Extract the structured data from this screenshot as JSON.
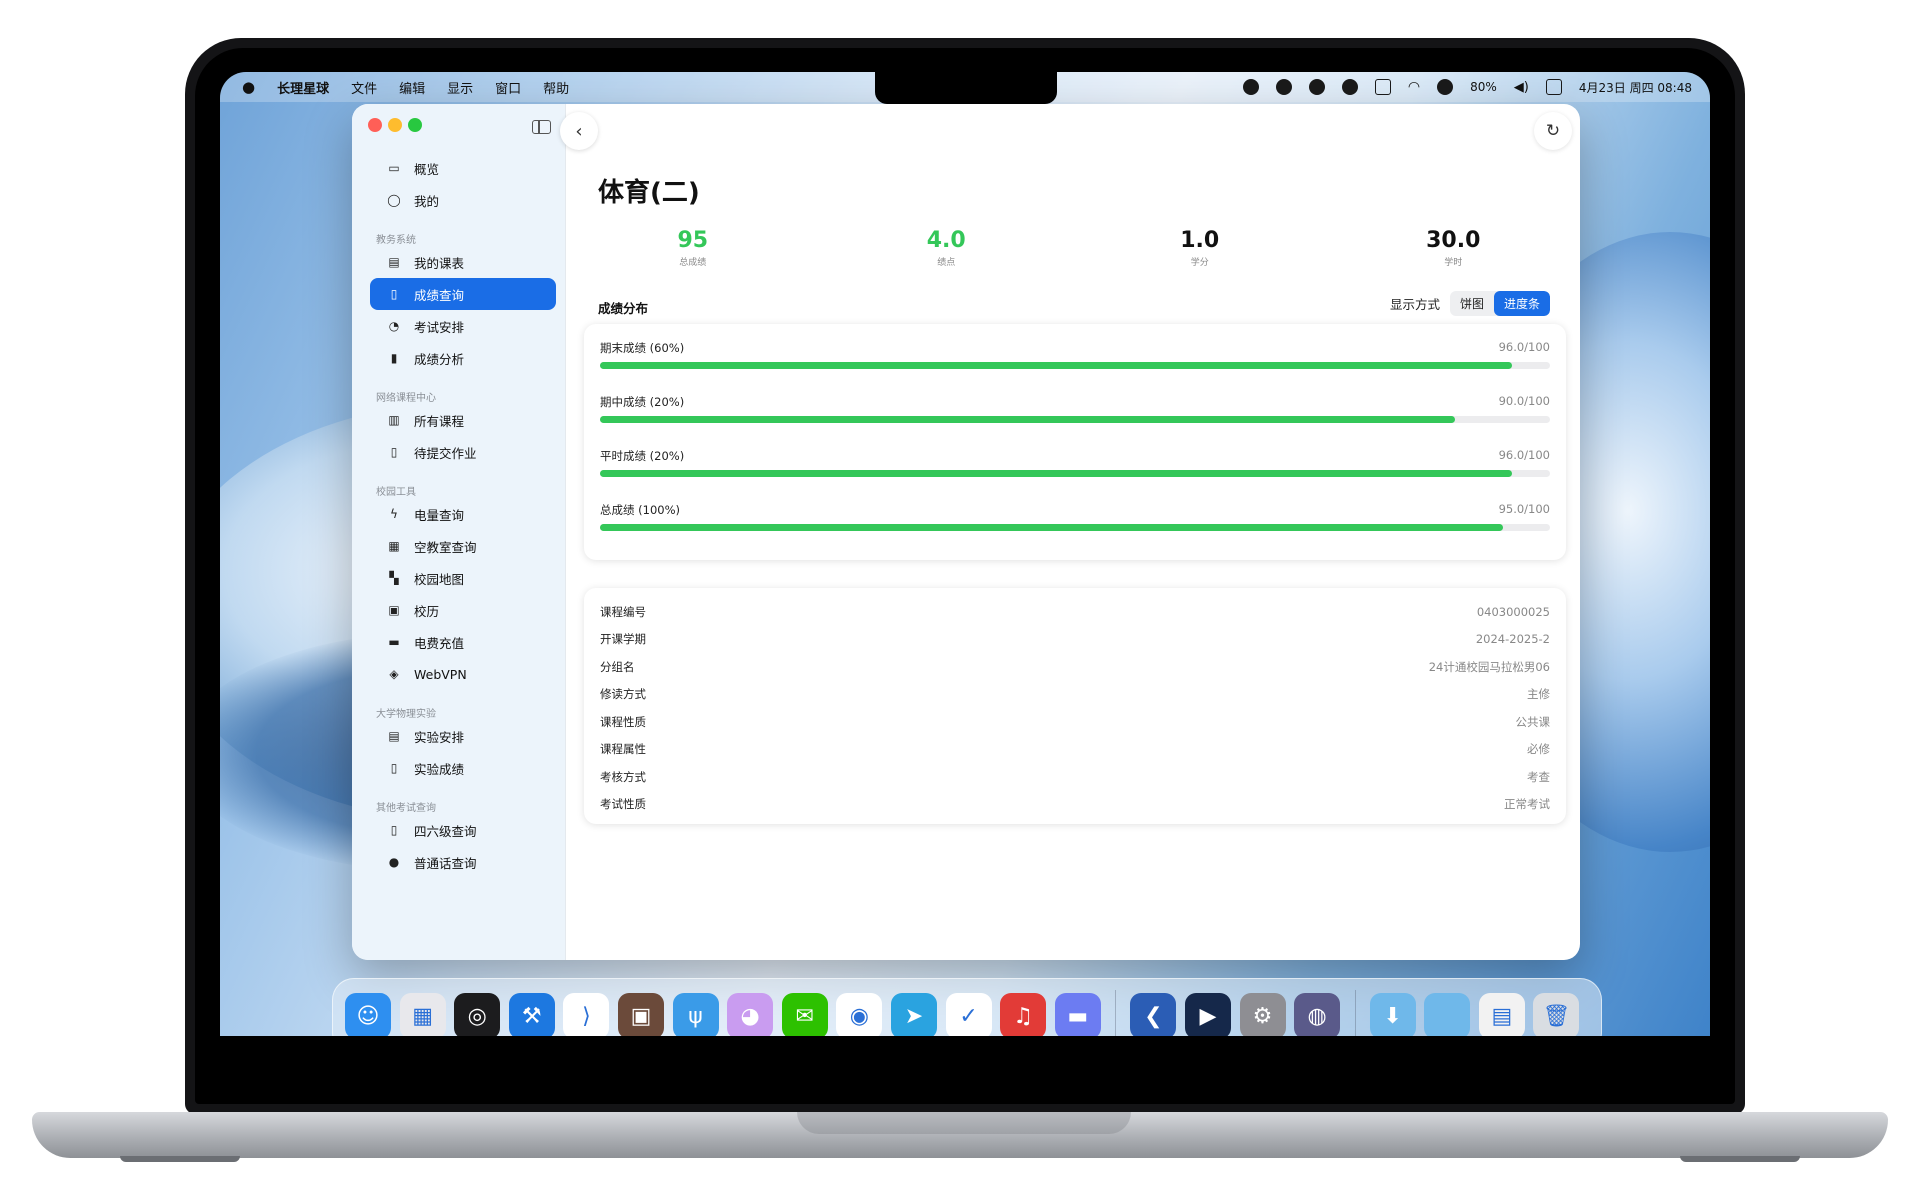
{
  "menubar": {
    "apple_icon": "apple-logo",
    "app_name": "长理星球",
    "menus": [
      "文件",
      "编辑",
      "显示",
      "窗口",
      "帮助"
    ],
    "battery": "80%",
    "datetime": "4月23日 周四 08:48"
  },
  "sidebar": {
    "top_items": [
      {
        "icon": "overview-icon",
        "label": "概览"
      },
      {
        "icon": "person-icon",
        "label": "我的"
      }
    ],
    "sections": [
      {
        "title": "教务系统",
        "items": [
          {
            "icon": "calendar-icon",
            "label": "我的课表"
          },
          {
            "icon": "document-search-icon",
            "label": "成绩查询",
            "active": true
          },
          {
            "icon": "exam-icon",
            "label": "考试安排"
          },
          {
            "icon": "chart-icon",
            "label": "成绩分析"
          }
        ]
      },
      {
        "title": "网络课程中心",
        "items": [
          {
            "icon": "books-icon",
            "label": "所有课程"
          },
          {
            "icon": "clipboard-icon",
            "label": "待提交作业"
          }
        ]
      },
      {
        "title": "校园工具",
        "items": [
          {
            "icon": "bolt-icon",
            "label": "电量查询"
          },
          {
            "icon": "building-icon",
            "label": "空教室查询"
          },
          {
            "icon": "map-icon",
            "label": "校园地图"
          },
          {
            "icon": "calendar-badge-icon",
            "label": "校历"
          },
          {
            "icon": "card-icon",
            "label": "电费充值"
          },
          {
            "icon": "shield-icon",
            "label": "WebVPN"
          }
        ]
      },
      {
        "title": "大学物理实验",
        "items": [
          {
            "icon": "calendar-icon",
            "label": "实验安排"
          },
          {
            "icon": "document-icon",
            "label": "实验成绩"
          }
        ]
      },
      {
        "title": "其他考试查询",
        "items": [
          {
            "icon": "document-icon",
            "label": "四六级查询"
          },
          {
            "icon": "exclamation-icon",
            "label": "普通话查询"
          }
        ]
      }
    ]
  },
  "course": {
    "title": "体育(二)",
    "stats": [
      {
        "value": "95",
        "label": "总成绩",
        "color": "#34c759"
      },
      {
        "value": "4.0",
        "label": "绩点",
        "color": "#34c759"
      },
      {
        "value": "1.0",
        "label": "学分",
        "color": "#111111"
      },
      {
        "value": "30.0",
        "label": "学时",
        "color": "#111111"
      }
    ]
  },
  "distribution": {
    "heading": "成绩分布",
    "mode_label": "显示方式",
    "mode_options": [
      "饼图",
      "进度条"
    ],
    "selected_mode": "进度条",
    "bars": [
      {
        "label": "期末成绩 (60%)",
        "value_text": "96.0/100",
        "fraction": 0.96
      },
      {
        "label": "期中成绩 (20%)",
        "value_text": "90.0/100",
        "fraction": 0.9
      },
      {
        "label": "平时成绩 (20%)",
        "value_text": "96.0/100",
        "fraction": 0.96
      },
      {
        "label": "总成绩 (100%)",
        "value_text": "95.0/100",
        "fraction": 0.95
      }
    ],
    "bar_color": "#34c759"
  },
  "info": [
    {
      "key": "课程编号",
      "value": "0403000025"
    },
    {
      "key": "开课学期",
      "value": "2024-2025-2"
    },
    {
      "key": "分组名",
      "value": "24计通校园马拉松男06"
    },
    {
      "key": "修读方式",
      "value": "主修"
    },
    {
      "key": "课程性质",
      "value": "公共课"
    },
    {
      "key": "课程属性",
      "value": "必修"
    },
    {
      "key": "考核方式",
      "value": "考查"
    },
    {
      "key": "考试性质",
      "value": "正常考试"
    }
  ],
  "dock": {
    "apps": [
      {
        "name": "finder-icon",
        "color": "#2e8ff0",
        "glyph": "☺",
        "running": true
      },
      {
        "name": "launchpad-icon",
        "color": "#e8e8ec",
        "glyph": "▦",
        "running": false
      },
      {
        "name": "siri-icon",
        "color": "#1c1c1e",
        "glyph": "◎",
        "running": true
      },
      {
        "name": "xcode-icon",
        "color": "#1d78e0",
        "glyph": "⚒",
        "running": true
      },
      {
        "name": "vscode-icon",
        "color": "#ffffff",
        "glyph": "⟩",
        "running": false
      },
      {
        "name": "terminal-cat-icon",
        "color": "#6b4a3a",
        "glyph": "▣",
        "running": true
      },
      {
        "name": "fork-icon",
        "color": "#3a9be8",
        "glyph": "ψ",
        "running": false
      },
      {
        "name": "cat-app-icon",
        "color": "#c99cf0",
        "glyph": "◕",
        "running": true
      },
      {
        "name": "wechat-icon",
        "color": "#2dc100",
        "glyph": "✉",
        "running": false
      },
      {
        "name": "qq-icon",
        "color": "#ffffff",
        "glyph": "◉",
        "running": true
      },
      {
        "name": "telegram-icon",
        "color": "#2aa3e0",
        "glyph": "➤",
        "running": true
      },
      {
        "name": "mail-app-icon",
        "color": "#ffffff",
        "glyph": "✓",
        "running": false
      },
      {
        "name": "netease-music-icon",
        "color": "#e23b37",
        "glyph": "♫",
        "running": true
      },
      {
        "name": "messages-icon",
        "color": "#6c7cf2",
        "glyph": "▬",
        "running": true
      }
    ],
    "apps2": [
      {
        "name": "kodi-icon",
        "color": "#2b5db5",
        "glyph": "❮",
        "running": false
      },
      {
        "name": "infuse-icon",
        "color": "#15284a",
        "glyph": "▶",
        "running": false
      },
      {
        "name": "system-settings-icon",
        "color": "#8e8e93",
        "glyph": "⚙",
        "running": false
      },
      {
        "name": "app-store-dev-icon",
        "color": "#5a5a8a",
        "glyph": "◍",
        "running": true
      }
    ],
    "folders": [
      {
        "name": "downloads-folder-icon",
        "color": "#6fb8ea",
        "glyph": "⬇"
      },
      {
        "name": "folder-icon",
        "color": "#6fb8ea",
        "glyph": ""
      },
      {
        "name": "screenshot-stack-icon",
        "color": "#f2f2f2",
        "glyph": "▤"
      },
      {
        "name": "trash-icon",
        "color": "#d9dde2",
        "glyph": "🗑"
      }
    ]
  }
}
